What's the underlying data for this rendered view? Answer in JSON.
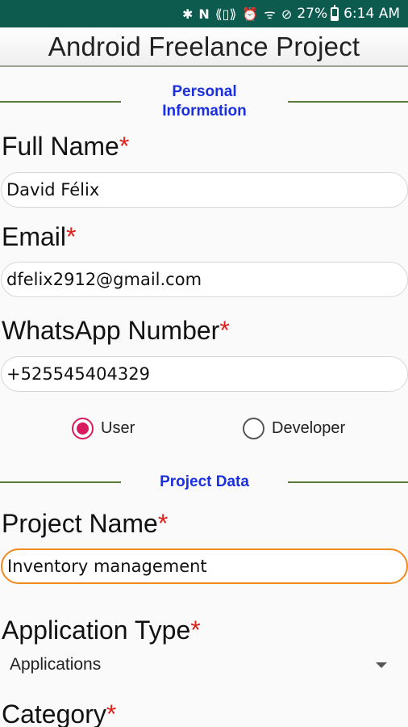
{
  "status_bar": {
    "icons": [
      "bluetooth-icon",
      "nfc-icon",
      "vibrate-icon",
      "alarm-icon",
      "wifi-icon",
      "do-not-disturb-icon"
    ],
    "battery": "27%",
    "time": "6:14 AM"
  },
  "app_bar": {
    "title": "Android Freelance Project"
  },
  "sections": {
    "personal": {
      "title_line1": "Personal",
      "title_line2": "Information"
    },
    "project": {
      "title": "Project Data"
    }
  },
  "fields": {
    "full_name": {
      "label": "Full Name",
      "value": "David Félix"
    },
    "email": {
      "label": "Email",
      "value": "dfelix2912@gmail.com"
    },
    "whatsapp": {
      "label": "WhatsApp Number",
      "value": "+525545404329"
    },
    "project_name": {
      "label": "Project Name",
      "value": "Inventory management"
    },
    "application_type": {
      "label": "Application Type",
      "value": "Applications"
    },
    "category": {
      "label": "Category"
    }
  },
  "required_mark": "*",
  "role": {
    "options": [
      "User",
      "Developer"
    ],
    "selected": "User"
  },
  "colors": {
    "status_bar": "#0d5a4f",
    "section_title": "#1a2fe0",
    "required": "#e0201a",
    "radio_accent": "#d81b60",
    "focus_border": "#f08a1c",
    "divider": "#5a7a3a"
  }
}
